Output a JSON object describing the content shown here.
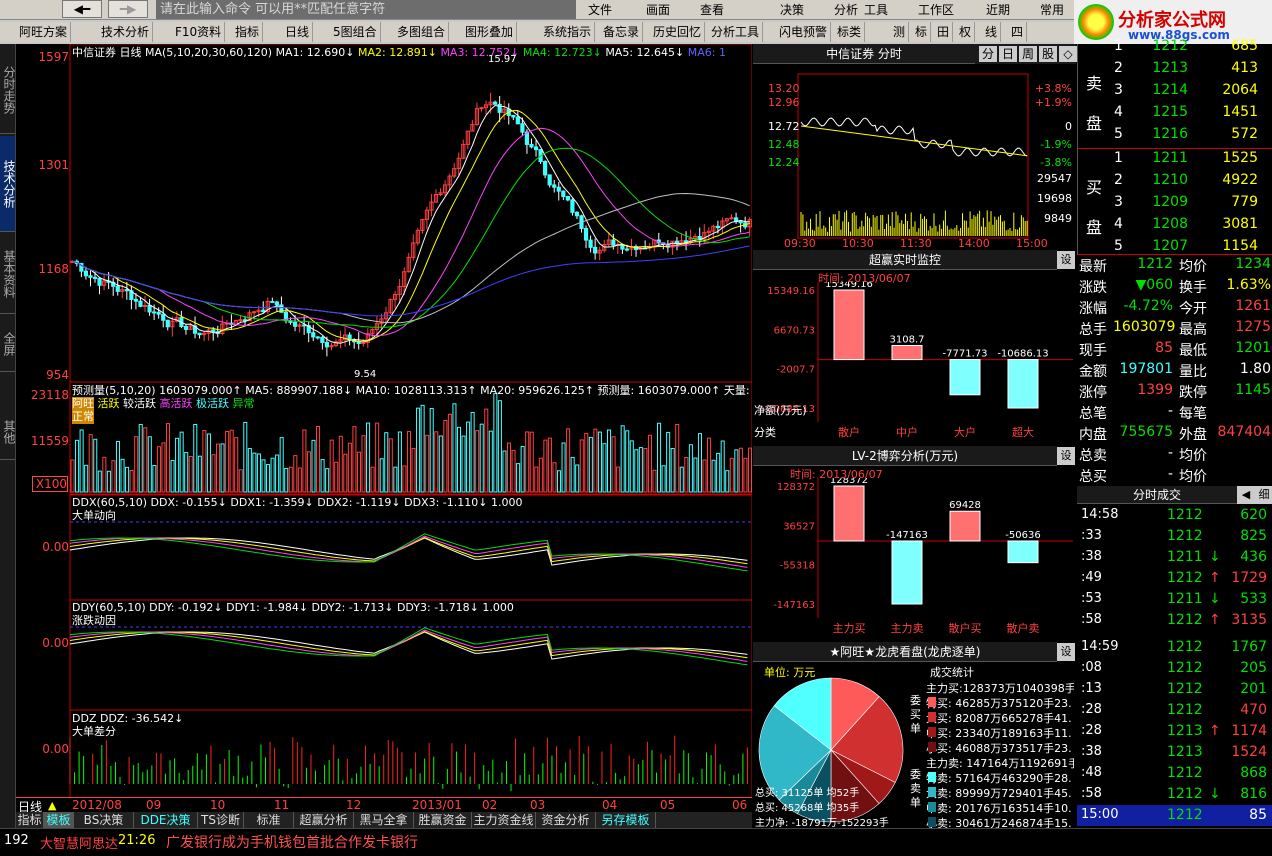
{
  "toolbar": {
    "back_icon": "left-arrow-icon",
    "fwd_icon": "right-arrow-icon",
    "cmd_placeholder": "请在此输入命令    可以用**匹配任意字符",
    "menus": [
      "文件",
      "画面",
      "查看",
      "决策",
      "分析",
      "工具",
      "工作区",
      "近期",
      "常用"
    ],
    "tabs2": [
      "阿旺方案",
      "技术分析",
      "F10资料",
      "指标",
      "日线",
      "5图组合",
      "多图组合",
      "图形叠加",
      "系统指示",
      "备忘录",
      "历史回忆",
      "分析工具",
      "闪电预警",
      "标类",
      "测",
      "标",
      "田",
      "权",
      "线",
      "四"
    ],
    "logo": "分析家公式网",
    "logo_url": "www.88gs.com"
  },
  "leftbar": [
    "分时走势",
    "技术分析",
    "基本资料",
    "全屏",
    "其他"
  ],
  "main": {
    "title": "中信证券 日线  MA(5,10,20,30,60,120)",
    "ma": [
      "MA1: 12.690↓",
      "MA2: 12.891↓",
      "MA3: 12.752↓",
      "MA4: 12.723↓",
      "MA5: 12.645↓",
      "MA6: 1"
    ],
    "yticks": [
      "1597",
      "1301",
      "1168",
      "954"
    ],
    "high_label": "15.97",
    "low_label": "9.54",
    "vol_title": "预测量(5,10,20) 1603079.000↑ MA5: 889907.188↓ MA10: 1028113.313↑ MA20: 959626.125↑ 预测量: 1603079.000↑ 天量:",
    "vol_legend": [
      "阿旺",
      "活跃",
      "较活跃",
      "高活跃",
      "极活跃",
      "异常"
    ],
    "vol_legend2": "正常",
    "vol_yticks": [
      "23118",
      "11559",
      "X100"
    ],
    "ddx_title": "DDX(60,5,10) DDX: -0.155↓ DDX1: -1.359↓ DDX2: -1.119↓ DDX3: -1.110↓ 1.000",
    "ddx_label": "大单动向",
    "ddx_y": "0.00",
    "ddy_title": "DDY(60,5,10) DDY: -0.192↓ DDY1: -1.984↓ DDY2: -1.713↓ DDY3: -1.718↓ 1.000",
    "ddy_label": "涨跌动因",
    "ddy_y": "0.00",
    "ddz_title": "DDZ DDZ: -36.542↓",
    "ddz_label": "大单差分",
    "ddz_y": "0.00",
    "period": "日线",
    "xdates": [
      "2012/08",
      "09",
      "10",
      "11",
      "12",
      "2013/01",
      "02",
      "03",
      "04",
      "05",
      "06"
    ]
  },
  "intraday": {
    "title": "中信证券 分时",
    "tabs": [
      "分",
      "日",
      "周",
      "股",
      "◇"
    ],
    "prices": [
      "13.20",
      "12.96",
      "12.72",
      "12.48",
      "12.24"
    ],
    "pcts": [
      "+3.8%",
      "+1.9%",
      "0",
      "-1.9%",
      "-3.8%"
    ],
    "vols": [
      "29547",
      "19698",
      "9849"
    ],
    "times": [
      "09:30",
      "10:30",
      "11:30",
      "14:00",
      "15:00"
    ]
  },
  "chaoying": {
    "title": "超赢实时监控",
    "date": "时间: 2013/06/07",
    "yt": [
      "15349.16",
      "6670.73",
      "-2007.7",
      "-10686.13"
    ],
    "vals": [
      "15349.16",
      "3108.7",
      "-7771.73",
      "-10686.13"
    ],
    "unit": "净额(万元)",
    "cat": "分类",
    "cats": [
      "散户",
      "中户",
      "大户",
      "超大"
    ],
    "set": "设"
  },
  "lv2": {
    "title": "LV-2博弈分析(万元)",
    "date": "时间: 2013/06/07",
    "yt": [
      "128372",
      "36527",
      "-55318",
      "-147163"
    ],
    "vals": [
      "128372",
      "-147163",
      "69428",
      "-50636"
    ],
    "cats": [
      "主力买",
      "主力卖",
      "散户买",
      "散户卖"
    ]
  },
  "dragon": {
    "title": "★阿旺★龙虎看盘(龙虎逐单)",
    "unit": "单位: 万元",
    "stat": "成交统计",
    "buy_lines": [
      "主力买:128373万1040398手",
      "特买: 46285万375120手23.",
      "大买: 82087万665278手41.",
      "中买: 23340万189163手11.",
      "小买: 46088万373517手23."
    ],
    "sell_lines": [
      "主力卖: 147164万1192691手",
      "特卖: 57164万463290手28.",
      "大卖: 89999万729401手45.",
      "中卖: 20176万163514手10.",
      "小卖: 30461万246874手15."
    ],
    "wei_buy": "委买单",
    "wei_sell": "委卖单",
    "pie_tot1": "总买: 31125单 均52手",
    "pie_tot2": "总买: 45268单 均35手",
    "pie_net": "主力净: -18791万-152293手"
  },
  "orderbook": {
    "sell_label": "卖盘",
    "buy_label": "买盘",
    "sells": [
      [
        "5",
        "1216",
        "572"
      ],
      [
        "4",
        "1215",
        "1451"
      ],
      [
        "3",
        "1214",
        "2064"
      ],
      [
        "2",
        "1213",
        "413"
      ],
      [
        "1",
        "1212",
        "685"
      ]
    ],
    "buys": [
      [
        "1",
        "1211",
        "1525"
      ],
      [
        "2",
        "1210",
        "4922"
      ],
      [
        "3",
        "1209",
        "779"
      ],
      [
        "4",
        "1208",
        "3081"
      ],
      [
        "5",
        "1207",
        "1154"
      ]
    ]
  },
  "quote": [
    [
      "最新",
      "1212",
      "均价",
      "1234"
    ],
    [
      "涨跌",
      "▼060",
      "换手",
      "1.63%"
    ],
    [
      "涨幅",
      "-4.72%",
      "今开",
      "1261"
    ],
    [
      "总手",
      "1603079",
      "最高",
      "1275"
    ],
    [
      "现手",
      "85",
      "最低",
      "1201"
    ],
    [
      "金额",
      "197801",
      "量比",
      "1.80"
    ],
    [
      "涨停",
      "1399",
      "跌停",
      "1145"
    ],
    [
      "总笔",
      "-",
      "每笔",
      ""
    ],
    [
      "内盘",
      "755675",
      "外盘",
      "847404"
    ],
    [
      "总卖",
      "-",
      "均价",
      ""
    ],
    [
      "总买",
      "-",
      "均价",
      ""
    ]
  ],
  "ticks_title": "分时成交",
  "ticks_btns": [
    "◀",
    "细"
  ],
  "ticks": [
    [
      "14:58",
      "1212",
      "",
      "620"
    ],
    [
      ":33",
      "1212",
      "",
      "825"
    ],
    [
      ":38",
      "1211",
      "↓",
      "436"
    ],
    [
      ":49",
      "1212",
      "↑",
      "1729"
    ],
    [
      ":53",
      "1211",
      "↓",
      "533"
    ],
    [
      ":58",
      "1212",
      "↑",
      "3135"
    ],
    [
      "14:59",
      "1212",
      "",
      "1767"
    ],
    [
      ":08",
      "1212",
      "",
      "205"
    ],
    [
      ":13",
      "1212",
      "",
      "201"
    ],
    [
      ":28",
      "1212",
      "",
      "470"
    ],
    [
      ":28",
      "1213",
      "↑",
      "1174"
    ],
    [
      ":38",
      "1213",
      "",
      "1524"
    ],
    [
      ":48",
      "1212",
      "",
      "868"
    ],
    [
      ":58",
      "1212",
      "↓",
      "816"
    ],
    [
      "15:00",
      "1212",
      "",
      "85"
    ]
  ],
  "bottomtabs": [
    "指标",
    "模板",
    "BS决策",
    "DDE决策",
    "TS诊断",
    "标准",
    "超赢分析",
    "黑马全拿",
    "胜赢资金",
    "主力资金线",
    "资金分析",
    "另存模板"
  ],
  "status": {
    "code": "192",
    "name": "大智慧阿思达",
    "time": "21:26",
    "news": "广发银行成为手机钱包首批合作发卡银行"
  },
  "colors": {
    "up": "#ff4040",
    "down": "#00e000",
    "panel_bg": "#000000"
  }
}
